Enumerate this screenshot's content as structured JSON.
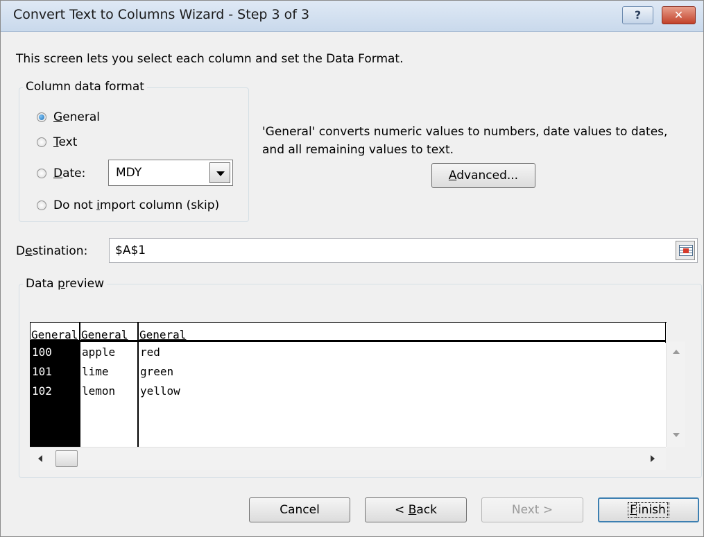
{
  "window": {
    "title": "Convert Text to Columns Wizard - Step 3 of 3",
    "help_label": "?",
    "close_label": "✕"
  },
  "intro_text": "This screen lets you select each column and set the Data Format.",
  "column_format": {
    "caption": "Column data format",
    "options": [
      {
        "key": "G",
        "rest": "eneral",
        "selected": true
      },
      {
        "key": "T",
        "rest": "ext",
        "selected": false
      },
      {
        "key": "D",
        "rest": "ate:",
        "selected": false
      },
      {
        "before": "Do not ",
        "key": "i",
        "rest": "mport column (skip)",
        "selected": false
      }
    ],
    "date_format_value": "MDY"
  },
  "description": "'General' converts numeric values to numbers, date values to dates, and all remaining values to text.",
  "advanced_button": {
    "key": "A",
    "rest": "dvanced..."
  },
  "destination": {
    "label_before": "D",
    "label_key": "e",
    "label_after": "stination:",
    "value": "$A$1"
  },
  "preview": {
    "caption_before": "Data ",
    "caption_key": "p",
    "caption_after": "review",
    "columns": [
      {
        "header": "General",
        "cells": [
          "100",
          "101",
          "102"
        ],
        "selected": true
      },
      {
        "header": "General",
        "cells": [
          "apple",
          "lime",
          "lemon"
        ],
        "selected": false
      },
      {
        "header": "General",
        "cells": [
          "red",
          "green",
          "yellow"
        ],
        "selected": false
      }
    ]
  },
  "buttons": {
    "cancel": "Cancel",
    "back_before": "< ",
    "back_key": "B",
    "back_after": "ack",
    "next": "Next >",
    "finish_key": "F",
    "finish_after": "inish"
  },
  "icons": {
    "radio_selected": "radio-selected-icon",
    "dropdown": "chevron-down-icon",
    "collapse": "collapse-dialog-icon"
  },
  "colors": {
    "accent": "#1f6fb6",
    "close": "#c2412a"
  }
}
